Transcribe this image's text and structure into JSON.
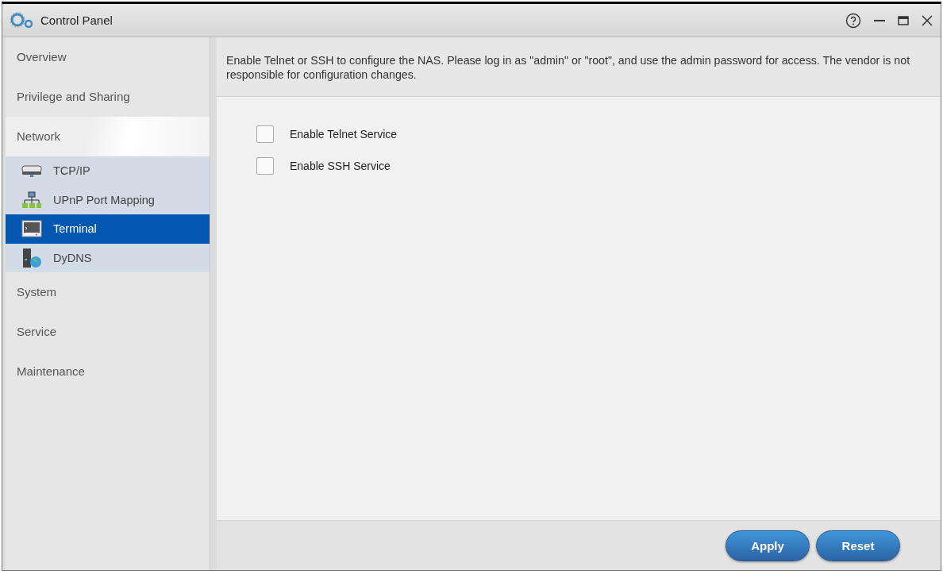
{
  "window": {
    "title": "Control Panel"
  },
  "sidebar": {
    "items": [
      {
        "label": "Overview",
        "selected": false
      },
      {
        "label": "Privilege and Sharing",
        "selected": false
      },
      {
        "label": "Network",
        "selected": true,
        "expanded": true,
        "children": [
          {
            "label": "TCP/IP",
            "kind": "tcpip",
            "selected": false
          },
          {
            "label": "UPnP Port Mapping",
            "kind": "upnp",
            "selected": false
          },
          {
            "label": "Terminal",
            "kind": "terminal",
            "selected": true
          },
          {
            "label": "DyDNS",
            "kind": "dydns",
            "selected": false
          }
        ]
      },
      {
        "label": "System",
        "selected": false
      },
      {
        "label": "Service",
        "selected": false
      },
      {
        "label": "Maintenance",
        "selected": false
      }
    ]
  },
  "notice": "Enable Telnet or SSH to configure the NAS. Please log in as \"admin\" or \"root\", and use the admin password for access. The vendor is not responsible for configuration changes.",
  "options": [
    {
      "label": "Enable Telnet Service",
      "checked": false
    },
    {
      "label": "Enable SSH Service",
      "checked": false
    }
  ],
  "buttons": [
    "Apply",
    "Reset"
  ]
}
